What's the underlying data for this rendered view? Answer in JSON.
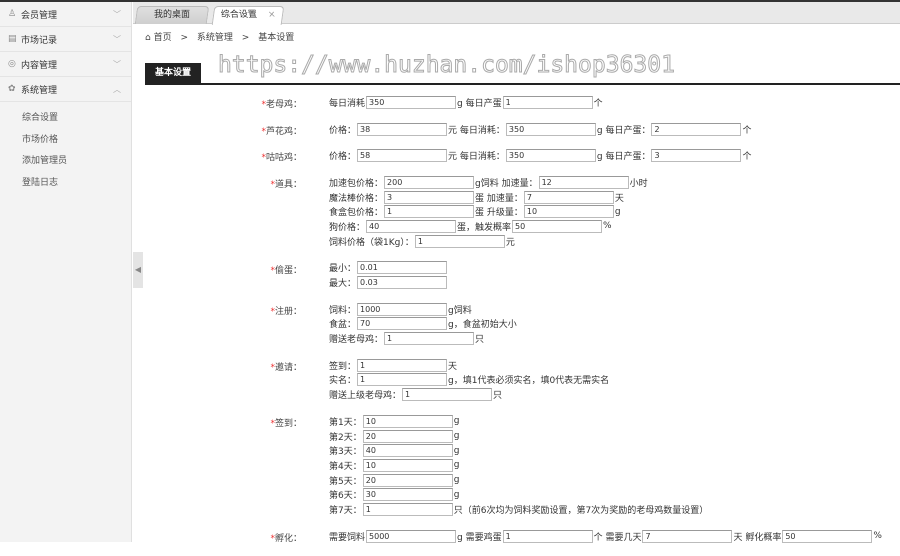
{
  "sidebar": {
    "menus": [
      {
        "icon": "user-icon",
        "glyph": "♙",
        "label": "会员管理",
        "expanded": false
      },
      {
        "icon": "chart-icon",
        "glyph": "▤",
        "label": "市场记录",
        "expanded": false
      },
      {
        "icon": "chat-icon",
        "glyph": "◎",
        "label": "内容管理",
        "expanded": false
      },
      {
        "icon": "gear-icon",
        "glyph": "✿",
        "label": "系统管理",
        "expanded": true
      }
    ],
    "submenu": [
      "综合设置",
      "市场价格",
      "添加管理员",
      "登陆日志"
    ]
  },
  "tabs": [
    {
      "label": "我的桌面"
    },
    {
      "label": "综合设置",
      "close": "×"
    }
  ],
  "breadcrumb": {
    "home": "首页",
    "sep": ">",
    "items": [
      "系统管理",
      "基本设置"
    ]
  },
  "section_title": "基本设置",
  "watermark": "https://www.huzhan.com/ishop36301",
  "form": [
    {
      "label": "老母鸡：",
      "lines": [
        [
          {
            "t": "每日消耗"
          },
          {
            "v": "350"
          },
          {
            "t": "g 每日产蛋"
          },
          {
            "v": "1"
          },
          {
            "t": "个"
          }
        ]
      ]
    },
    {
      "label": "芦花鸡：",
      "lines": [
        [
          {
            "t": "价格："
          },
          {
            "v": "38"
          },
          {
            "t": "元 每日消耗："
          },
          {
            "v": "350"
          },
          {
            "t": "g 每日产蛋："
          },
          {
            "v": "2"
          },
          {
            "t": "个"
          }
        ]
      ]
    },
    {
      "label": "咕咕鸡：",
      "lines": [
        [
          {
            "t": "价格："
          },
          {
            "v": "58"
          },
          {
            "t": "元 每日消耗："
          },
          {
            "v": "350"
          },
          {
            "t": "g 每日产蛋："
          },
          {
            "v": "3"
          },
          {
            "t": "个"
          }
        ]
      ]
    },
    {
      "label": "道具：",
      "lines": [
        [
          {
            "t": "加速包价格："
          },
          {
            "v": "200"
          },
          {
            "t": "g饲料 加速量："
          },
          {
            "v": "12"
          },
          {
            "t": "小时"
          }
        ],
        [
          {
            "t": "魔法棒价格："
          },
          {
            "v": "3"
          },
          {
            "t": "蛋 加速量："
          },
          {
            "v": "7"
          },
          {
            "t": "天"
          }
        ],
        [
          {
            "t": "食盒包价格："
          },
          {
            "v": "1"
          },
          {
            "t": "蛋 升级量："
          },
          {
            "v": "10"
          },
          {
            "t": "g"
          }
        ],
        [
          {
            "t": "狗价格："
          },
          {
            "v": "40"
          },
          {
            "t": "蛋，触发概率"
          },
          {
            "v": "50"
          },
          {
            "t": "%"
          }
        ],
        [
          {
            "t": "饲料价格（袋1Kg）："
          },
          {
            "v": "1"
          },
          {
            "t": "元"
          }
        ]
      ]
    },
    {
      "label": "偷蛋：",
      "lines": [
        [
          {
            "t": "最小："
          },
          {
            "v": "0.01"
          }
        ],
        [
          {
            "t": "最大："
          },
          {
            "v": "0.03"
          }
        ]
      ]
    },
    {
      "label": "注册：",
      "lines": [
        [
          {
            "t": "饲料："
          },
          {
            "v": "1000"
          },
          {
            "t": "g饲料"
          }
        ],
        [
          {
            "t": "食盆："
          },
          {
            "v": "70"
          },
          {
            "t": "g，食盆初始大小"
          }
        ],
        [
          {
            "t": "赠送老母鸡："
          },
          {
            "v": "1"
          },
          {
            "t": "只"
          }
        ]
      ]
    },
    {
      "label": "邀请：",
      "lines": [
        [
          {
            "t": "签到："
          },
          {
            "v": "1"
          },
          {
            "t": "天"
          }
        ],
        [
          {
            "t": "实名："
          },
          {
            "v": "1"
          },
          {
            "t": "g，填1代表必须实名，填0代表无需实名"
          }
        ],
        [
          {
            "t": "赠送上级老母鸡："
          },
          {
            "v": "1"
          },
          {
            "t": "只"
          }
        ]
      ]
    },
    {
      "label": "签到：",
      "lines": [
        [
          {
            "t": "第1天："
          },
          {
            "v": "10"
          },
          {
            "t": "g"
          }
        ],
        [
          {
            "t": "第2天："
          },
          {
            "v": "20"
          },
          {
            "t": "g"
          }
        ],
        [
          {
            "t": "第3天："
          },
          {
            "v": "40"
          },
          {
            "t": "g"
          }
        ],
        [
          {
            "t": "第4天："
          },
          {
            "v": "10"
          },
          {
            "t": "g"
          }
        ],
        [
          {
            "t": "第5天："
          },
          {
            "v": "20"
          },
          {
            "t": "g"
          }
        ],
        [
          {
            "t": "第6天："
          },
          {
            "v": "30"
          },
          {
            "t": "g"
          }
        ],
        [
          {
            "t": "第7天："
          },
          {
            "v": "1"
          },
          {
            "t": "只（前6次均为饲料奖励设置，第7次为奖励的老母鸡数量设置）"
          }
        ]
      ]
    },
    {
      "label": "孵化：",
      "lines": [
        [
          {
            "t": "需要饲料"
          },
          {
            "v": "5000"
          },
          {
            "t": "g 需要鸡蛋"
          },
          {
            "v": "1"
          },
          {
            "t": "个 需要几天"
          },
          {
            "v": "7"
          },
          {
            "t": "天 孵化概率"
          },
          {
            "v": "50"
          },
          {
            "t": "%"
          }
        ]
      ]
    }
  ],
  "required_mark": "*"
}
